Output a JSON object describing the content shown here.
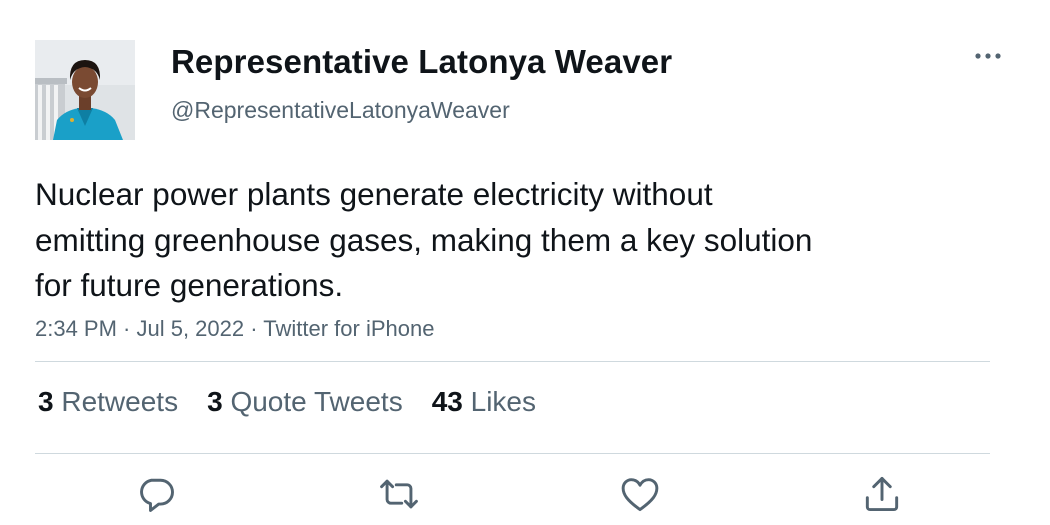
{
  "author": {
    "display_name": "Representative Latonya Weaver",
    "handle": "@RepresentativeLatonyaWeaver"
  },
  "tweet": {
    "text_lines": [
      "Nuclear power plants generate electricity without",
      "emitting greenhouse gases, making them a key solution",
      "for future generations."
    ],
    "meta": "2:34 PM · Jul 5, 2022 · Twitter for iPhone"
  },
  "stats": [
    {
      "count": "3",
      "label": "Retweets"
    },
    {
      "count": "3",
      "label": "Quote Tweets"
    },
    {
      "count": "43",
      "label": "Likes"
    }
  ],
  "icons": {
    "more": "more-horizontal-icon",
    "reply": "reply-icon",
    "retweet": "retweet-icon",
    "like": "heart-icon",
    "share": "share-icon"
  },
  "colors": {
    "text": "#0f1419",
    "secondary": "#536471",
    "divider": "#cfd9de"
  }
}
